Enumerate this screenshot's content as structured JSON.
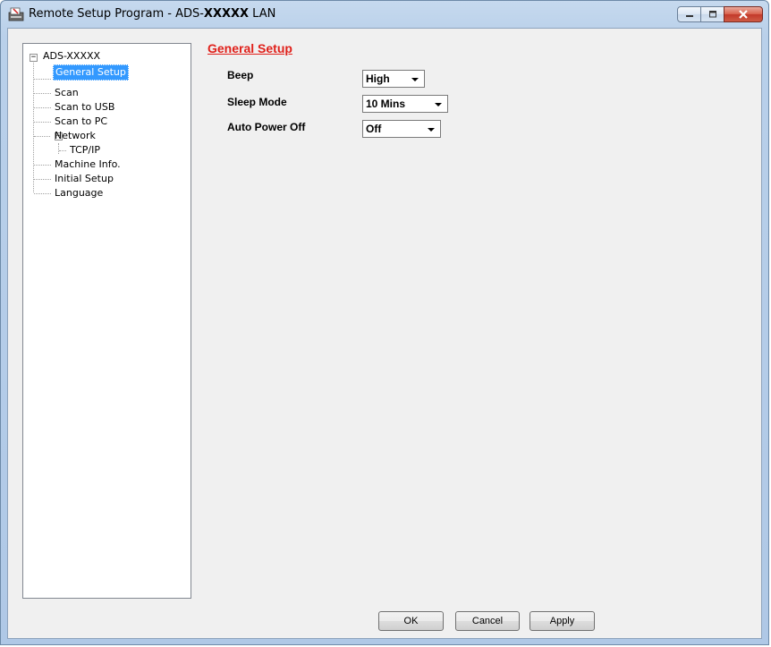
{
  "window": {
    "title_prefix": "Remote Setup Program - ADS-",
    "title_model": "XXXXX",
    "title_suffix": " LAN"
  },
  "tree": {
    "root": "ADS-XXXXX",
    "items": [
      {
        "label": "General Setup",
        "selected": true
      },
      {
        "label": "Scan"
      },
      {
        "label": "Scan to USB"
      },
      {
        "label": "Scan to PC"
      },
      {
        "label": "Network",
        "children": [
          {
            "label": "TCP/IP"
          }
        ]
      },
      {
        "label": "Machine Info."
      },
      {
        "label": "Initial Setup"
      },
      {
        "label": "Language"
      }
    ]
  },
  "panel": {
    "title": "General Setup",
    "settings": [
      {
        "label": "Beep",
        "value": "High"
      },
      {
        "label": "Sleep Mode",
        "value": "10 Mins"
      },
      {
        "label": "Auto Power Off",
        "value": "Off"
      }
    ]
  },
  "buttons": {
    "ok": "OK",
    "cancel": "Cancel",
    "apply": "Apply"
  },
  "colors": {
    "section_title": "#e0201a",
    "selection": "#3399ff"
  }
}
